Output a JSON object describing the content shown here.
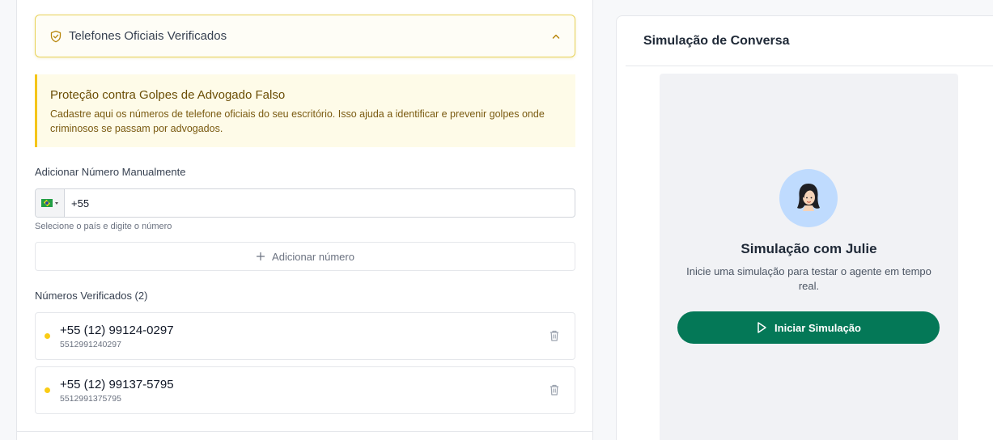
{
  "colors": {
    "accent_yellow": "#f5c518",
    "primary_green": "#047857",
    "avatar_bg": "#bfdbfe"
  },
  "accordion": {
    "icon": "shield-check-icon",
    "title": "Telefones Oficiais Verificados",
    "chevron_icon": "chevron-up-icon"
  },
  "warning": {
    "title": "Proteção contra Golpes de Advogado Falso",
    "text": "Cadastre aqui os números de telefone oficiais do seu escritório. Isso ajuda a identificar e prevenir golpes onde criminosos se passam por advogados."
  },
  "manual": {
    "label": "Adicionar Número Manualmente",
    "country_flag": "brazil-flag-icon",
    "phone_value": "+55",
    "helper": "Selecione o país e digite o número",
    "add_icon": "plus-icon",
    "add_label": "Adicionar número"
  },
  "verified": {
    "label": "Números Verificados (2)",
    "items": [
      {
        "formatted": "+55 (12) 99124-0297",
        "raw": "5512991240297"
      },
      {
        "formatted": "+55 (12) 99137-5795",
        "raw": "5512991375795"
      }
    ]
  },
  "simulation": {
    "header_title": "Simulação de Conversa",
    "avatar_icon": "woman-avatar-icon",
    "title": "Simulação com Julie",
    "description": "Inicie uma simulação para testar o agente em tempo real.",
    "button_icon": "play-icon",
    "button_label": "Iniciar Simulação"
  }
}
